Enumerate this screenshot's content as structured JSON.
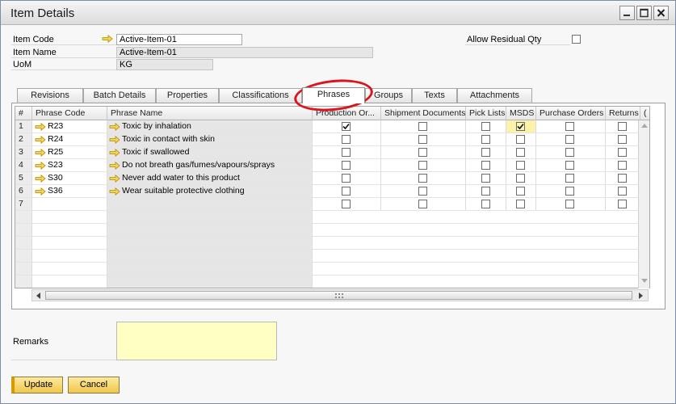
{
  "window": {
    "title": "Item Details"
  },
  "fields": {
    "item_code_label": "Item Code",
    "item_code_value": "Active-Item-01",
    "item_name_label": "Item Name",
    "item_name_value": "Active-Item-01",
    "uom_label": "UoM",
    "uom_value": "KG",
    "allow_residual_label": "Allow Residual Qty",
    "allow_residual_checked": false
  },
  "tabs": [
    {
      "label": "Revisions"
    },
    {
      "label": "Batch Details"
    },
    {
      "label": "Properties"
    },
    {
      "label": "Classifications"
    },
    {
      "label": "Phrases",
      "active": true
    },
    {
      "label": "Groups"
    },
    {
      "label": "Texts"
    },
    {
      "label": "Attachments"
    }
  ],
  "grid": {
    "columns": [
      "#",
      "Phrase Code",
      "Phrase Name",
      "Production Or...",
      "Shipment Documents",
      "Pick Lists",
      "MSDS",
      "Purchase Orders",
      "Returns",
      "("
    ],
    "rows": [
      {
        "num": "1",
        "code": "R23",
        "name": "Toxic by inhalation",
        "prod": true,
        "ship": false,
        "pick": false,
        "msds": true,
        "po": false,
        "ret": false
      },
      {
        "num": "2",
        "code": "R24",
        "name": "Toxic in contact with skin",
        "prod": false,
        "ship": false,
        "pick": false,
        "msds": false,
        "po": false,
        "ret": false
      },
      {
        "num": "3",
        "code": "R25",
        "name": "Toxic if swallowed",
        "prod": false,
        "ship": false,
        "pick": false,
        "msds": false,
        "po": false,
        "ret": false
      },
      {
        "num": "4",
        "code": "S23",
        "name": "Do not breath gas/fumes/vapours/sprays",
        "prod": false,
        "ship": false,
        "pick": false,
        "msds": false,
        "po": false,
        "ret": false
      },
      {
        "num": "5",
        "code": "S30",
        "name": "Never add water to this product",
        "prod": false,
        "ship": false,
        "pick": false,
        "msds": false,
        "po": false,
        "ret": false
      },
      {
        "num": "6",
        "code": "S36",
        "name": "Wear suitable protective clothing",
        "prod": false,
        "ship": false,
        "pick": false,
        "msds": false,
        "po": false,
        "ret": false
      },
      {
        "num": "7",
        "code": "",
        "name": "",
        "prod": false,
        "ship": false,
        "pick": false,
        "msds": false,
        "po": false,
        "ret": false
      }
    ],
    "empty_rows": 6
  },
  "remarks": {
    "label": "Remarks",
    "value": ""
  },
  "buttons": {
    "update": "Update",
    "cancel": "Cancel"
  },
  "colors": {
    "accent": "#f1c74c",
    "highlight": "#d9161d",
    "remarks_bg": "#ffffc4"
  },
  "icons": [
    "link-arrow-icon",
    "minimize-icon",
    "maximize-icon",
    "close-icon",
    "scroll-arrow-icon"
  ]
}
